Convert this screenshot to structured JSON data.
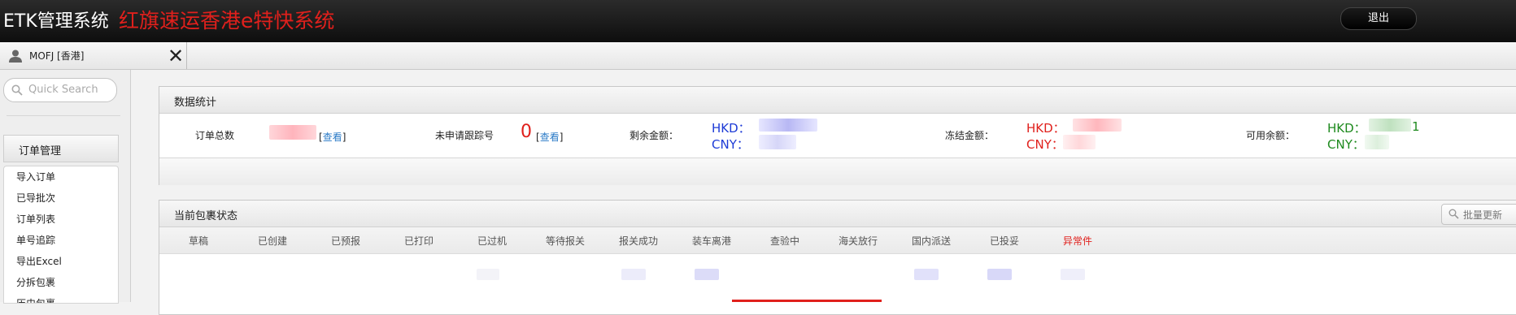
{
  "header": {
    "app_title": "ETK管理系统",
    "app_subtitle": "红旗速运香港e特快系统",
    "logout_label": "退出"
  },
  "userbar": {
    "user_name": "MOFJ [香港]",
    "close_glyph": "✕"
  },
  "sidebar": {
    "search_placeholder": "Quick Search",
    "menu_title": "订单管理",
    "items": [
      {
        "label": "导入订单"
      },
      {
        "label": "已导批次"
      },
      {
        "label": "订单列表"
      },
      {
        "label": "单号追踪"
      },
      {
        "label": "导出Excel"
      },
      {
        "label": "分拆包裹"
      },
      {
        "label": "历史包裹"
      }
    ]
  },
  "stats": {
    "title": "数据统计",
    "total_orders_label": "订单总数",
    "view_link": "查看",
    "bracket_open": "[",
    "bracket_close": "]",
    "untracked_label": "未申请跟踪号",
    "untracked_count": "0",
    "balance_label": "剩余金额：",
    "frozen_label": "冻结金额：",
    "available_label": "可用余额：",
    "hkd_label": "HKD：",
    "cny_label": "CNY：",
    "available_hkd_tail": "1",
    "colors": {
      "balance": "#1d3bd6",
      "frozen": "#e0201c",
      "available": "#1e8a1e"
    }
  },
  "status": {
    "title": "当前包裹状态",
    "refresh_label": "批量更新",
    "columns": [
      {
        "label": "草稿"
      },
      {
        "label": "已创建"
      },
      {
        "label": "已预报"
      },
      {
        "label": "已打印"
      },
      {
        "label": "已过机"
      },
      {
        "label": "等待报关"
      },
      {
        "label": "报关成功"
      },
      {
        "label": "装车离港"
      },
      {
        "label": "查验中"
      },
      {
        "label": "海关放行"
      },
      {
        "label": "国内派送"
      },
      {
        "label": "已投妥"
      },
      {
        "label": "异常件"
      }
    ]
  },
  "icons": {
    "user": "user-icon",
    "close": "close-icon",
    "search": "search-icon",
    "refresh": "search-icon"
  }
}
